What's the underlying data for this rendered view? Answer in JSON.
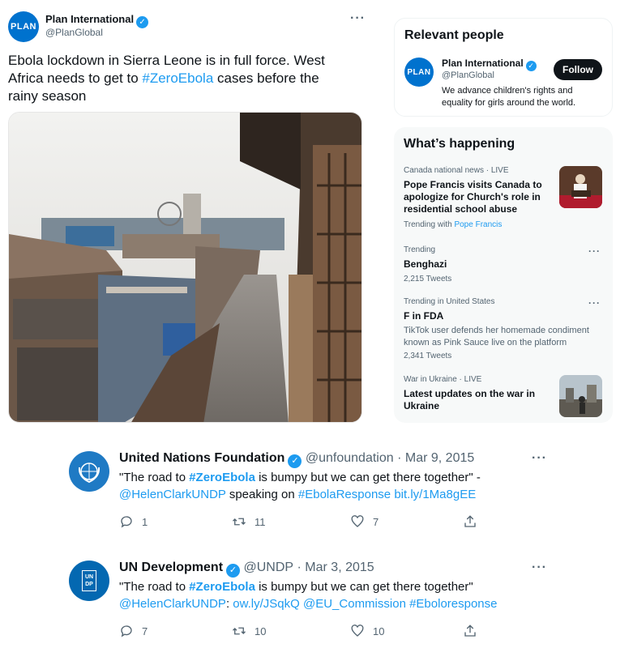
{
  "main_tweet": {
    "name": "Plan International",
    "handle": "@PlanGlobal",
    "avatar_text": "PLAN",
    "text_part1": "Ebola lockdown in Sierra Leone is in full force. West Africa needs to get to ",
    "hashtag": "#ZeroEbola",
    "text_part2": " cases before the rainy season",
    "more_icon": "more-dots-icon"
  },
  "relevant_people": {
    "title": "Relevant people",
    "person": {
      "name": "Plan International",
      "handle": "@PlanGlobal",
      "bio": "We advance children's rights and equality for girls around the world.",
      "follow_label": "Follow",
      "avatar_text": "PLAN"
    }
  },
  "whats_happening": {
    "title": "What’s happening",
    "trends": [
      {
        "meta": "Canada national news · LIVE",
        "title": "Pope Francis visits Canada to apologize for Church's role in residential school abuse",
        "trending_with_label": "Trending with",
        "trending_with_link": "Pope Francis"
      },
      {
        "meta": "Trending",
        "title": "Benghazi",
        "count": "2,215 Tweets"
      },
      {
        "meta": "Trending in United States",
        "title": "F in FDA",
        "desc": "TikTok user defends her homemade condiment known as Pink Sauce live on the platform",
        "count": "2,341 Tweets"
      },
      {
        "meta": "War in Ukraine · LIVE",
        "title": "Latest updates on the war in Ukraine"
      }
    ]
  },
  "replies": [
    {
      "name": "United Nations Foundation",
      "handle": "@unfoundation",
      "date": "· Mar 9, 2015",
      "line1_a": "\"The road to ",
      "line1_tag": "#ZeroEbola",
      "line1_b": " is bumpy but we can get there together\" -",
      "line2_mention": "@HelenClarkUNDP",
      "line2_mid": " speaking on ",
      "line2_tag": "#EbolaResponse",
      "line2_space": " ",
      "line2_link": "bit.ly/1Ma8gEE",
      "replies": "1",
      "retweets": "11",
      "likes": "7"
    },
    {
      "name": "UN Development",
      "handle": "@UNDP",
      "date": "· Mar 3, 2015",
      "avatar_text": "UN DP",
      "line1_a": "\"The road to ",
      "line1_tag": "#ZeroEbola",
      "line1_b": " is bumpy but we can get there together\"",
      "line2_mention": "@HelenClarkUNDP",
      "line2_colon": ": ",
      "line2_link": "ow.ly/JSqkQ",
      "line2_space1": " ",
      "line2_mention2": "@EU_Commission",
      "line2_space2": " ",
      "line2_tag": "#Eboloresponse",
      "replies": "7",
      "retweets": "10",
      "likes": "10"
    }
  ],
  "colors": {
    "accent": "#1d9bf0",
    "plan_blue": "#0072ce",
    "un_blue": "#1f7ac4",
    "undp_blue": "#0468b1"
  }
}
